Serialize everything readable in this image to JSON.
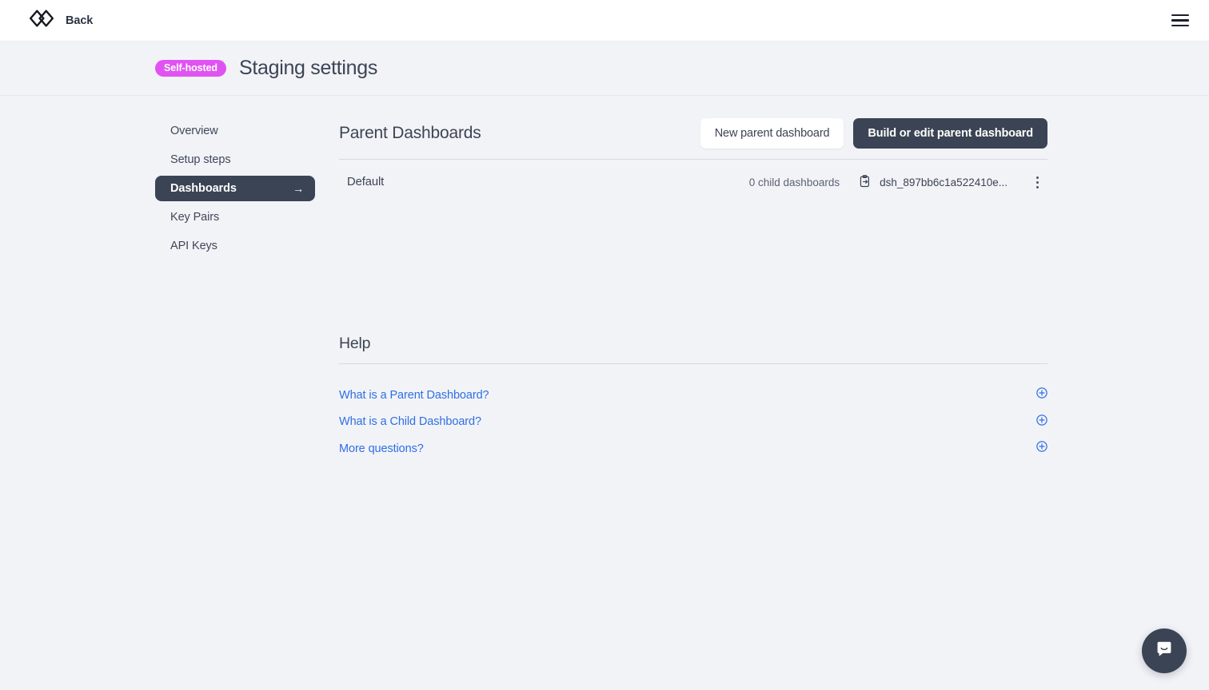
{
  "topbar": {
    "logo_icon": "double-diamond-logo",
    "back_label": "Back",
    "menu_icon": "hamburger-menu-icon"
  },
  "header": {
    "badge": "Self-hosted",
    "title": "Staging settings"
  },
  "sidebar": {
    "items": [
      {
        "label": "Overview",
        "active": false
      },
      {
        "label": "Setup steps",
        "active": false
      },
      {
        "label": "Dashboards",
        "active": true,
        "arrow": "→"
      },
      {
        "label": "Key Pairs",
        "active": false
      },
      {
        "label": "API Keys",
        "active": false
      }
    ]
  },
  "main": {
    "section_title": "Parent Dashboards",
    "new_button": "New parent dashboard",
    "build_button": "Build or edit parent dashboard",
    "dashboards": [
      {
        "name": "Default",
        "child_count": "0 child dashboards",
        "id": "dsh_897bb6c1a522410e...",
        "copy_icon": "clipboard-copy-icon",
        "menu_icon": "kebab-menu-icon"
      }
    ]
  },
  "help": {
    "title": "Help",
    "items": [
      {
        "label": "What is a Parent Dashboard?",
        "icon": "plus-circle-icon"
      },
      {
        "label": "What is a Child Dashboard?",
        "icon": "plus-circle-icon"
      },
      {
        "label": "More questions?",
        "icon": "plus-circle-icon"
      }
    ]
  },
  "chat": {
    "icon": "chat-bubble-icon"
  },
  "colors": {
    "page_bg": "#f2f3f7",
    "dark": "#3b4454",
    "badge": "#e152f2",
    "link": "#2f6fe4",
    "divider": "#d6d9e0"
  }
}
